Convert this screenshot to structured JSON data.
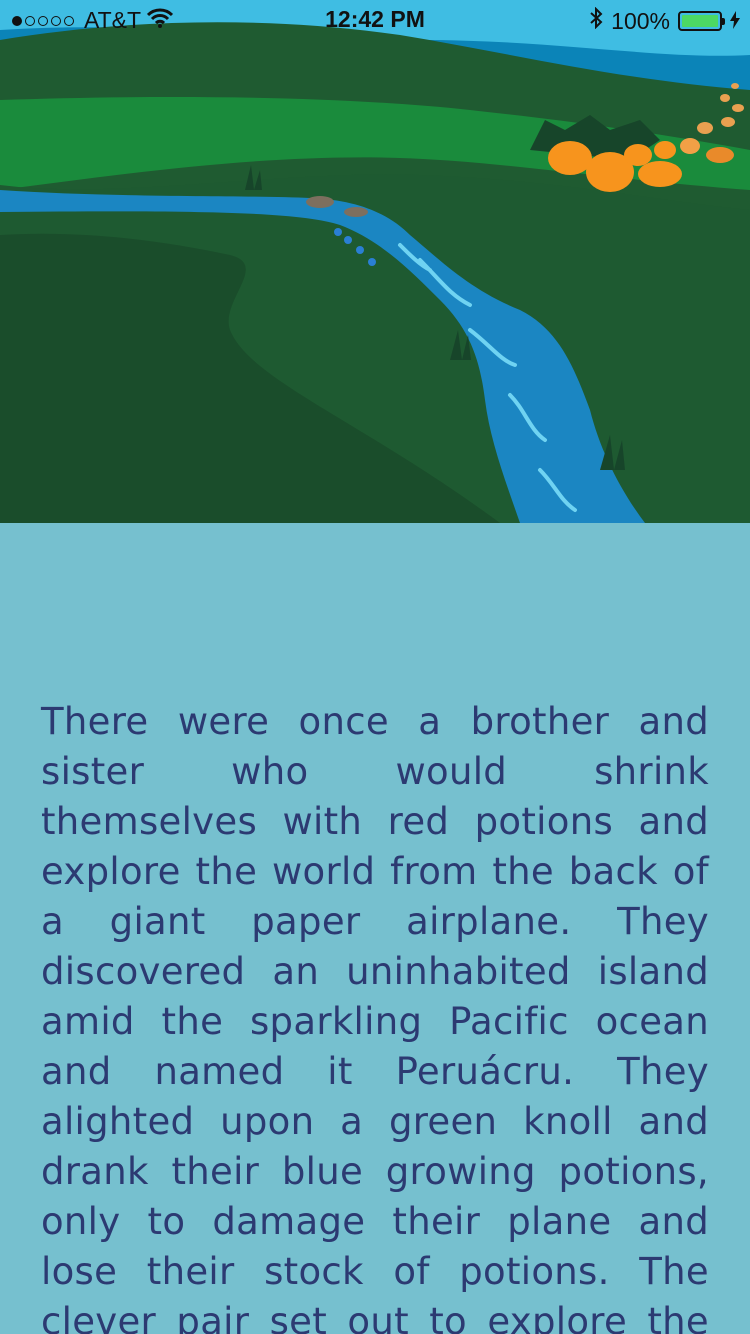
{
  "status_bar": {
    "carrier": "AT&T",
    "time": "12:42 PM",
    "battery": "100%",
    "signal_bars_filled": 1,
    "signal_bars_total": 5,
    "battery_level": 1.0,
    "icons": [
      "wifi-icon",
      "bluetooth-icon",
      "battery-icon",
      "charging-bolt-icon"
    ]
  },
  "hero": {
    "description_icon": "landscape-illustration-icon",
    "colors": {
      "sky": "#3fbde3",
      "ocean": "#0b84b8",
      "hills": "#1d5d33",
      "river": "#1b86c2",
      "pumpkin": "#f7941d"
    }
  },
  "story": {
    "text": "There were once a brother and sister who would shrink themselves with red potions and explore the world from the back of a giant paper airplane. They discovered an uninhabited island amid the sparkling Pacific ocean and named it Peruácru. They alighted upon a green knoll and drank their blue growing potions, only to damage their plane and lose their stock of potions. The clever pair set out to explore the island and hopefully find"
  },
  "colors": {
    "page_background": "#76c0cf",
    "text": "#2c3a72"
  }
}
